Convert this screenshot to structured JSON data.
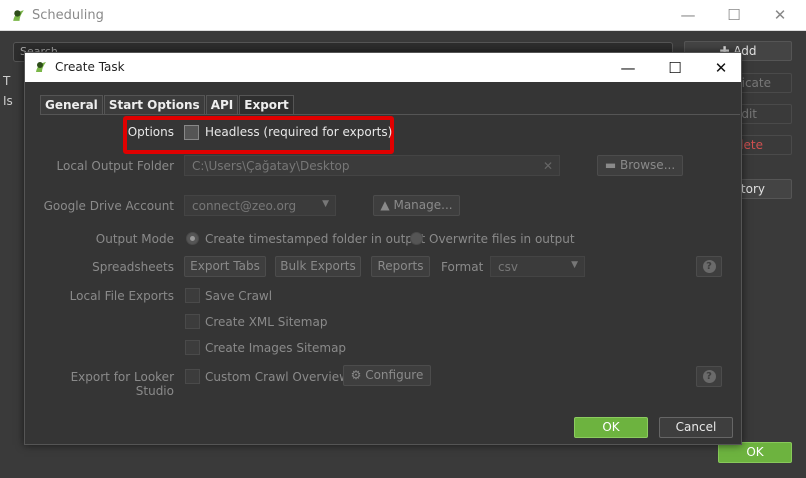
{
  "background_window": {
    "title": "Scheduling",
    "search_placeholder": "Search",
    "list_fragment_1": "T",
    "list_fragment_2": "Is",
    "buttons": {
      "add": "Add",
      "duplicate": "licate",
      "edit": "dit",
      "delete": "elete",
      "history": "story"
    },
    "ok_label": "OK"
  },
  "dialog": {
    "title": "Create Task",
    "tabs": [
      "General",
      "Start Options",
      "API",
      "Export"
    ],
    "active_tab": "Export",
    "options": {
      "label": "Options",
      "headless_label": "Headless (required for exports)",
      "headless_checked": false
    },
    "local_output_folder": {
      "label": "Local Output Folder",
      "value": "C:\\Users\\Çağatay\\Desktop",
      "browse_label": "Browse..."
    },
    "google_drive": {
      "label": "Google Drive Account",
      "selected": "connect@zeo.org",
      "manage_label": "Manage..."
    },
    "output_mode": {
      "label": "Output Mode",
      "option_timestamped": "Create timestamped folder in output",
      "option_overwrite": "Overwrite files in output",
      "selected": "timestamped"
    },
    "spreadsheets": {
      "label": "Spreadsheets",
      "export_tabs": "Export Tabs",
      "bulk_exports": "Bulk Exports",
      "reports": "Reports",
      "format_label": "Format",
      "format_value": "csv",
      "help": "?"
    },
    "local_file_exports": {
      "label": "Local File Exports",
      "save_crawl": "Save Crawl",
      "xml_sitemap": "Create XML Sitemap",
      "images_sitemap": "Create Images Sitemap"
    },
    "looker_studio": {
      "label": "Export for Looker Studio",
      "custom_overview": "Custom Crawl Overview",
      "configure": "Configure",
      "help": "?"
    },
    "ok_label": "OK",
    "cancel_label": "Cancel"
  },
  "colors": {
    "accent_green": "#6db33f",
    "highlight_red": "#e00000",
    "dialog_bg": "#353535"
  }
}
